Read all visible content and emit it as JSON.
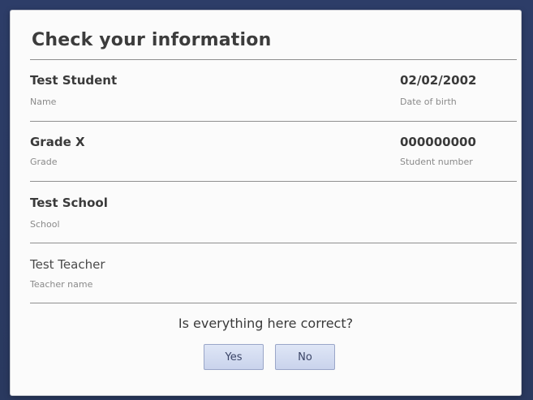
{
  "dialog": {
    "title": "Check your information",
    "question": "Is everything here correct?"
  },
  "fields": {
    "name": {
      "value": "Test Student",
      "label": "Name"
    },
    "dob": {
      "value": "02/02/2002",
      "label": "Date of birth"
    },
    "grade": {
      "value": "Grade X",
      "label": "Grade"
    },
    "student_number": {
      "value": "000000000",
      "label": "Student number"
    },
    "school": {
      "value": "Test School",
      "label": "School"
    },
    "teacher": {
      "value": "Test Teacher",
      "label": "Teacher name"
    }
  },
  "buttons": {
    "yes_label": "Yes",
    "no_label": "No"
  },
  "colors": {
    "background": "#2b3a63",
    "dialog": "#fbfbfb",
    "button": "#d3dbf0"
  }
}
